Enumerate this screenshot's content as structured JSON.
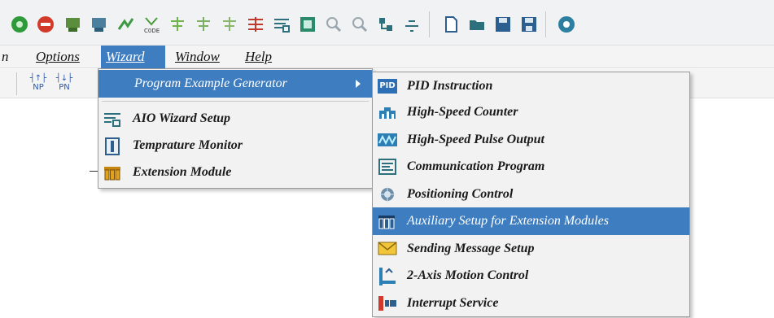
{
  "menubar": {
    "cut_left": "n",
    "options": "Options",
    "wizard": "Wizard",
    "window": "Window",
    "help": "Help"
  },
  "toolbar2": {
    "np": "NP",
    "pn": "PN"
  },
  "wizard_menu": {
    "items": [
      {
        "label": "Program Example Generator",
        "icon": "submenu-arrow"
      },
      {
        "label": "AIO Wizard Setup",
        "icon": "aio-wizard-icon"
      },
      {
        "label": "Temprature Monitor",
        "icon": "temperature-icon"
      },
      {
        "label": "Extension Module",
        "icon": "extension-module-icon"
      }
    ]
  },
  "submenu": {
    "items": [
      {
        "label": "PID Instruction",
        "icon": "pid-icon",
        "icon_text": "PID"
      },
      {
        "label": "High-Speed Counter",
        "icon": "counter-icon"
      },
      {
        "label": "High-Speed Pulse Output",
        "icon": "pulse-output-icon"
      },
      {
        "label": "Communication Program",
        "icon": "communication-icon"
      },
      {
        "label": "Positioning Control",
        "icon": "positioning-icon"
      },
      {
        "label": "Auxiliary Setup for Extension Modules",
        "icon": "extension-module-icon",
        "highlighted": true
      },
      {
        "label": "Sending Message Setup",
        "icon": "envelope-icon"
      },
      {
        "label": "2-Axis Motion Control",
        "icon": "axis-icon"
      },
      {
        "label": "Interrupt Service",
        "icon": "interrupt-icon"
      }
    ]
  },
  "colors": {
    "highlight": "#3d7dc0",
    "menu_bg": "#f2f2f2"
  }
}
